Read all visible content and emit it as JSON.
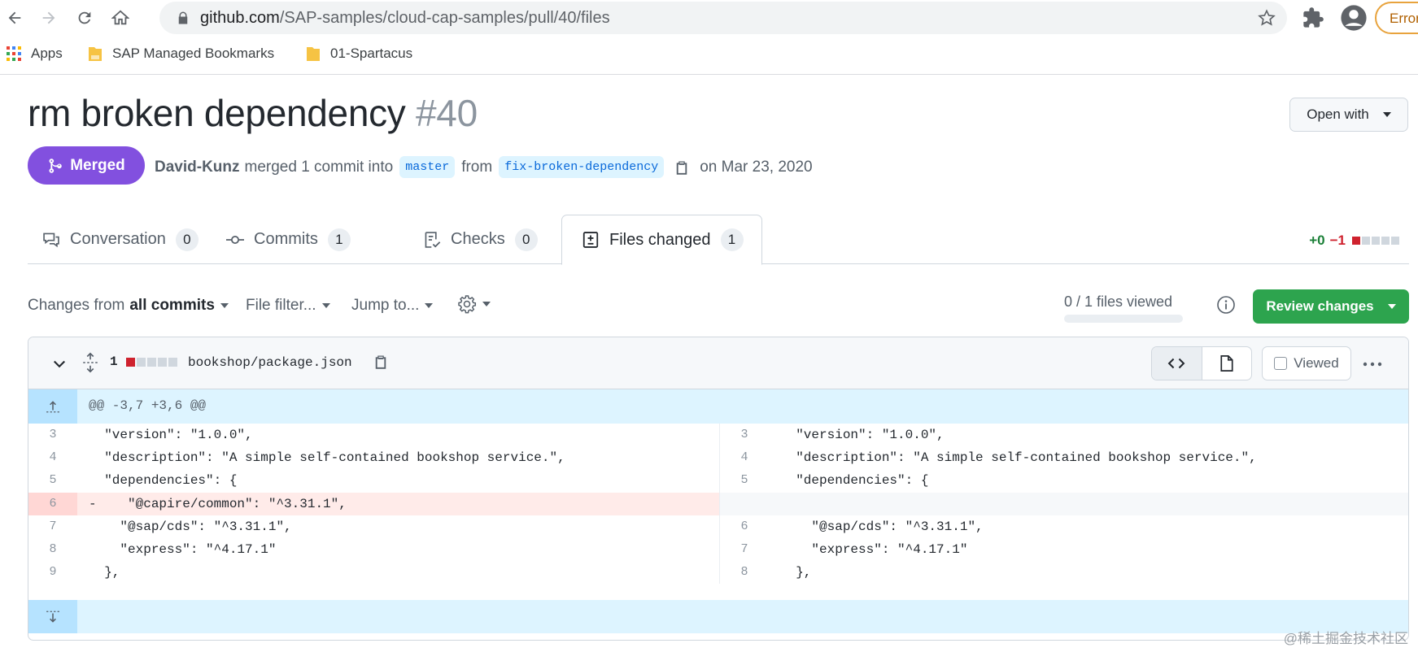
{
  "browser": {
    "url_host": "github.com",
    "url_path": "/SAP-samples/cloud-cap-samples/pull/40/files",
    "error_chip": "Error",
    "bookmarks": [
      {
        "label": "Apps",
        "icon": "apps-grid-icon"
      },
      {
        "label": "SAP Managed Bookmarks",
        "icon": "folder-icon"
      },
      {
        "label": "01-Spartacus",
        "icon": "folder-icon"
      }
    ]
  },
  "pr": {
    "title": "rm broken dependency",
    "number": "#40",
    "open_with_label": "Open with",
    "state_label": "Merged",
    "author": "David-Kunz",
    "merged_text": "merged 1 commit into",
    "base_branch": "master",
    "from_text": "from",
    "head_branch": "fix-broken-dependency",
    "date_text": "on Mar 23, 2020"
  },
  "tabs": [
    {
      "label": "Conversation",
      "count": "0"
    },
    {
      "label": "Commits",
      "count": "1"
    },
    {
      "label": "Checks",
      "count": "0"
    },
    {
      "label": "Files changed",
      "count": "1"
    }
  ],
  "diffstat": {
    "additions": "+0",
    "deletions": "−1"
  },
  "toolbar": {
    "changes_from": "Changes from",
    "changes_from_value": "all commits",
    "file_filter": "File filter...",
    "jump_to": "Jump to...",
    "files_viewed": "0 / 1 files viewed",
    "files_viewed_fraction": 0,
    "review_button": "Review changes"
  },
  "file": {
    "change_count": "1",
    "path": "bookshop/package.json",
    "viewed_label": "Viewed",
    "hunk_header": "@@ -3,7 +3,6 @@",
    "rows": [
      {
        "left_num": "3",
        "left_code": "  \"version\": \"1.0.0\",",
        "right_num": "3",
        "right_code": "  \"version\": \"1.0.0\",",
        "type": "context"
      },
      {
        "left_num": "4",
        "left_code": "  \"description\": \"A simple self-contained bookshop service.\",",
        "right_num": "4",
        "right_code": "  \"description\": \"A simple self-contained bookshop service.\",",
        "type": "context"
      },
      {
        "left_num": "5",
        "left_code": "  \"dependencies\": {",
        "right_num": "5",
        "right_code": "  \"dependencies\": {",
        "type": "context"
      },
      {
        "left_num": "6",
        "left_code": "-    \"@capire/common\": \"^3.31.1\",",
        "right_num": "",
        "right_code": "",
        "type": "deletion"
      },
      {
        "left_num": "7",
        "left_code": "    \"@sap/cds\": \"^3.31.1\",",
        "right_num": "6",
        "right_code": "    \"@sap/cds\": \"^3.31.1\",",
        "type": "context"
      },
      {
        "left_num": "8",
        "left_code": "    \"express\": \"^4.17.1\"",
        "right_num": "7",
        "right_code": "    \"express\": \"^4.17.1\"",
        "type": "context"
      },
      {
        "left_num": "9",
        "left_code": "  },",
        "right_num": "8",
        "right_code": "  },",
        "type": "context"
      }
    ]
  },
  "watermark": "@稀土掘金技术社区"
}
